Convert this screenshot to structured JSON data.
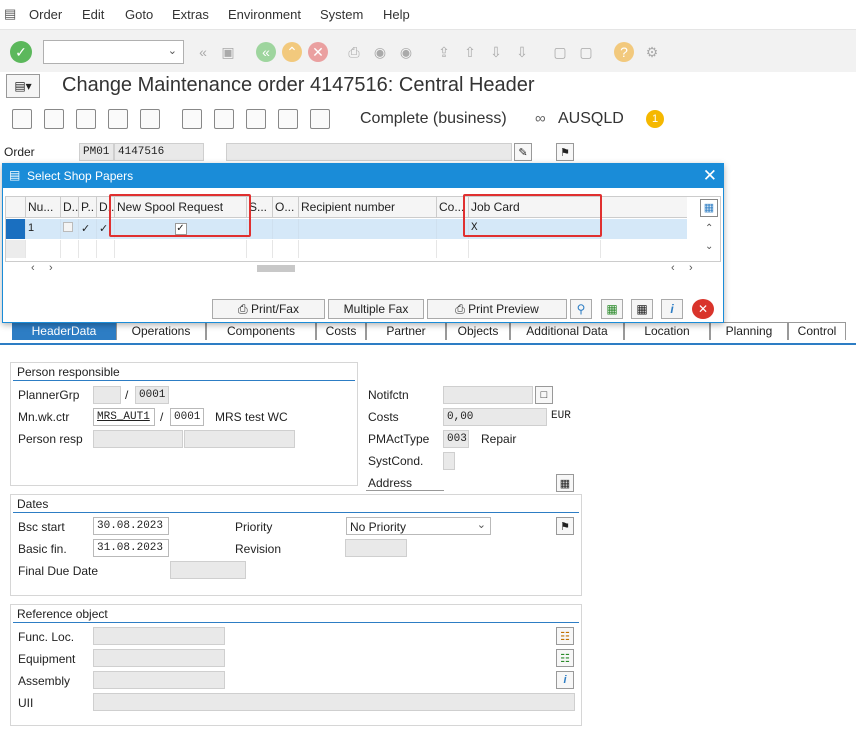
{
  "menu": [
    "Order",
    "Edit",
    "Goto",
    "Extras",
    "Environment",
    "System",
    "Help"
  ],
  "title": "Change Maintenance order 4147516: Central Header",
  "apptoolbar": {
    "status": "Complete (business)",
    "org": "AUSQLD"
  },
  "order": {
    "label": "Order",
    "type": "PM01",
    "number": "4147516"
  },
  "dialog": {
    "title": "Select Shop Papers",
    "columns": [
      "Nu...",
      "D..",
      "P..",
      "D..",
      "New Spool Request",
      "S...",
      "O...",
      "Recipient number",
      "Co...",
      "Job Card"
    ],
    "row": {
      "num": "1",
      "job_card": "X"
    },
    "buttons": {
      "print_fax": "Print/Fax",
      "multiple_fax": "Multiple Fax",
      "print_preview": "Print Preview"
    }
  },
  "tabs": [
    "HeaderData",
    "Operations",
    "Components",
    "Costs",
    "Partner",
    "Objects",
    "Additional Data",
    "Location",
    "Planning",
    "Control"
  ],
  "person": {
    "title": "Person responsible",
    "planner_label": "PlannerGrp",
    "planner_plant": "0001",
    "wc_label": "Mn.wk.ctr",
    "wc_value": "MRS_AUT1",
    "wc_plant": "0001",
    "wc_desc": "MRS test WC",
    "resp_label": "Person resp"
  },
  "right": {
    "notif_label": "Notifctn",
    "costs_label": "Costs",
    "costs_value": "0,00",
    "currency": "EUR",
    "pmact_label": "PMActType",
    "pmact_value": "003",
    "pmact_desc": "Repair",
    "syst_label": "SystCond.",
    "addr_label": "Address"
  },
  "dates": {
    "title": "Dates",
    "bsc_start_label": "Bsc start",
    "bsc_start": "30.08.2023",
    "basic_fin_label": "Basic fin.",
    "basic_fin": "31.08.2023",
    "final_due_label": "Final Due Date",
    "priority_label": "Priority",
    "priority_value": "No Priority",
    "revision_label": "Revision"
  },
  "ref": {
    "title": "Reference object",
    "func_loc": "Func. Loc.",
    "equipment": "Equipment",
    "assembly": "Assembly",
    "uii": "UII"
  }
}
